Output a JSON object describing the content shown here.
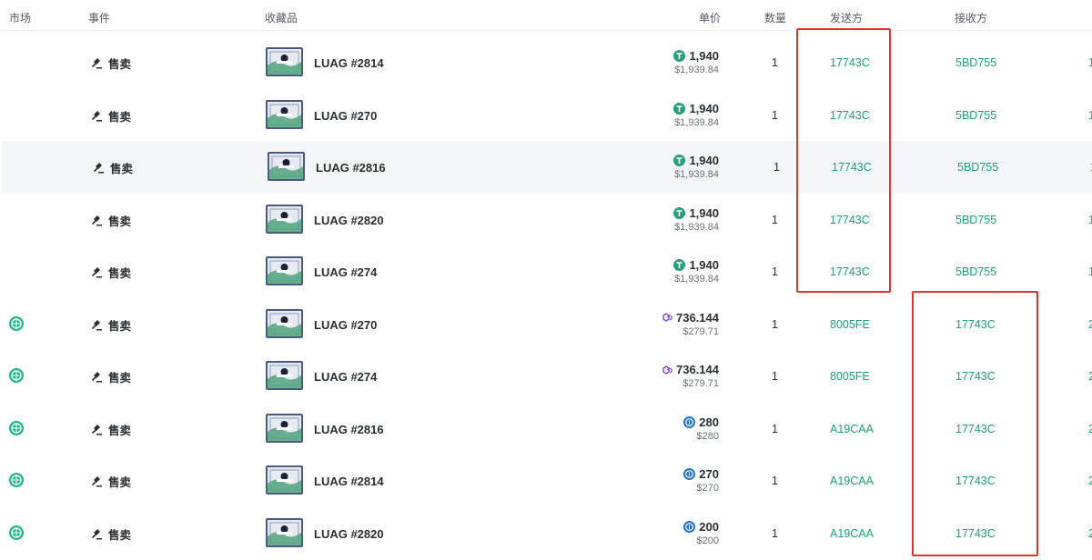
{
  "header": {
    "market": "市场",
    "event": "事件",
    "item": "收藏品",
    "price": "单价",
    "qty": "数量",
    "from": "发送方",
    "to": "接收方"
  },
  "colors": {
    "link": "#1ca27a",
    "highlight_box": "#e0342f",
    "usdt": "#26a17b",
    "usdc": "#2775ca",
    "matic": "#8247e5"
  },
  "rows": [
    {
      "market_icon": "",
      "event": "售卖",
      "item": "LUAG #2814",
      "currency_icon": "usdt-icon",
      "price": "1,940",
      "usd": "$1,939.84",
      "qty": "1",
      "from": "17743C",
      "to": "5BD755",
      "extra": "1"
    },
    {
      "market_icon": "",
      "event": "售卖",
      "item": "LUAG #270",
      "currency_icon": "usdt-icon",
      "price": "1,940",
      "usd": "$1,939.84",
      "qty": "1",
      "from": "17743C",
      "to": "5BD755",
      "extra": "1"
    },
    {
      "market_icon": "",
      "event": "售卖",
      "item": "LUAG #2816",
      "currency_icon": "usdt-icon",
      "price": "1,940",
      "usd": "$1,939.84",
      "qty": "1",
      "from": "17743C",
      "to": "5BD755",
      "extra": "1"
    },
    {
      "market_icon": "",
      "event": "售卖",
      "item": "LUAG #2820",
      "currency_icon": "usdt-icon",
      "price": "1,940",
      "usd": "$1,939.84",
      "qty": "1",
      "from": "17743C",
      "to": "5BD755",
      "extra": "1"
    },
    {
      "market_icon": "",
      "event": "售卖",
      "item": "LUAG #274",
      "currency_icon": "usdt-icon",
      "price": "1,940",
      "usd": "$1,939.84",
      "qty": "1",
      "from": "17743C",
      "to": "5BD755",
      "extra": "1"
    },
    {
      "market_icon": "market-logo-icon",
      "event": "售卖",
      "item": "LUAG #270",
      "currency_icon": "matic-icon",
      "price": "736.144",
      "usd": "$279.71",
      "qty": "1",
      "from": "8005FE",
      "to": "17743C",
      "extra": "2"
    },
    {
      "market_icon": "market-logo-icon",
      "event": "售卖",
      "item": "LUAG #274",
      "currency_icon": "matic-icon",
      "price": "736.144",
      "usd": "$279.71",
      "qty": "1",
      "from": "8005FE",
      "to": "17743C",
      "extra": "2"
    },
    {
      "market_icon": "market-logo-icon",
      "event": "售卖",
      "item": "LUAG #2816",
      "currency_icon": "usdc-icon",
      "price": "280",
      "usd": "$280",
      "qty": "1",
      "from": "A19CAA",
      "to": "17743C",
      "extra": "2"
    },
    {
      "market_icon": "market-logo-icon",
      "event": "售卖",
      "item": "LUAG #2814",
      "currency_icon": "usdc-icon",
      "price": "270",
      "usd": "$270",
      "qty": "1",
      "from": "A19CAA",
      "to": "17743C",
      "extra": "2"
    },
    {
      "market_icon": "market-logo-icon",
      "event": "售卖",
      "item": "LUAG #2820",
      "currency_icon": "usdc-icon",
      "price": "200",
      "usd": "$200",
      "qty": "1",
      "from": "A19CAA",
      "to": "17743C",
      "extra": "2"
    }
  ]
}
